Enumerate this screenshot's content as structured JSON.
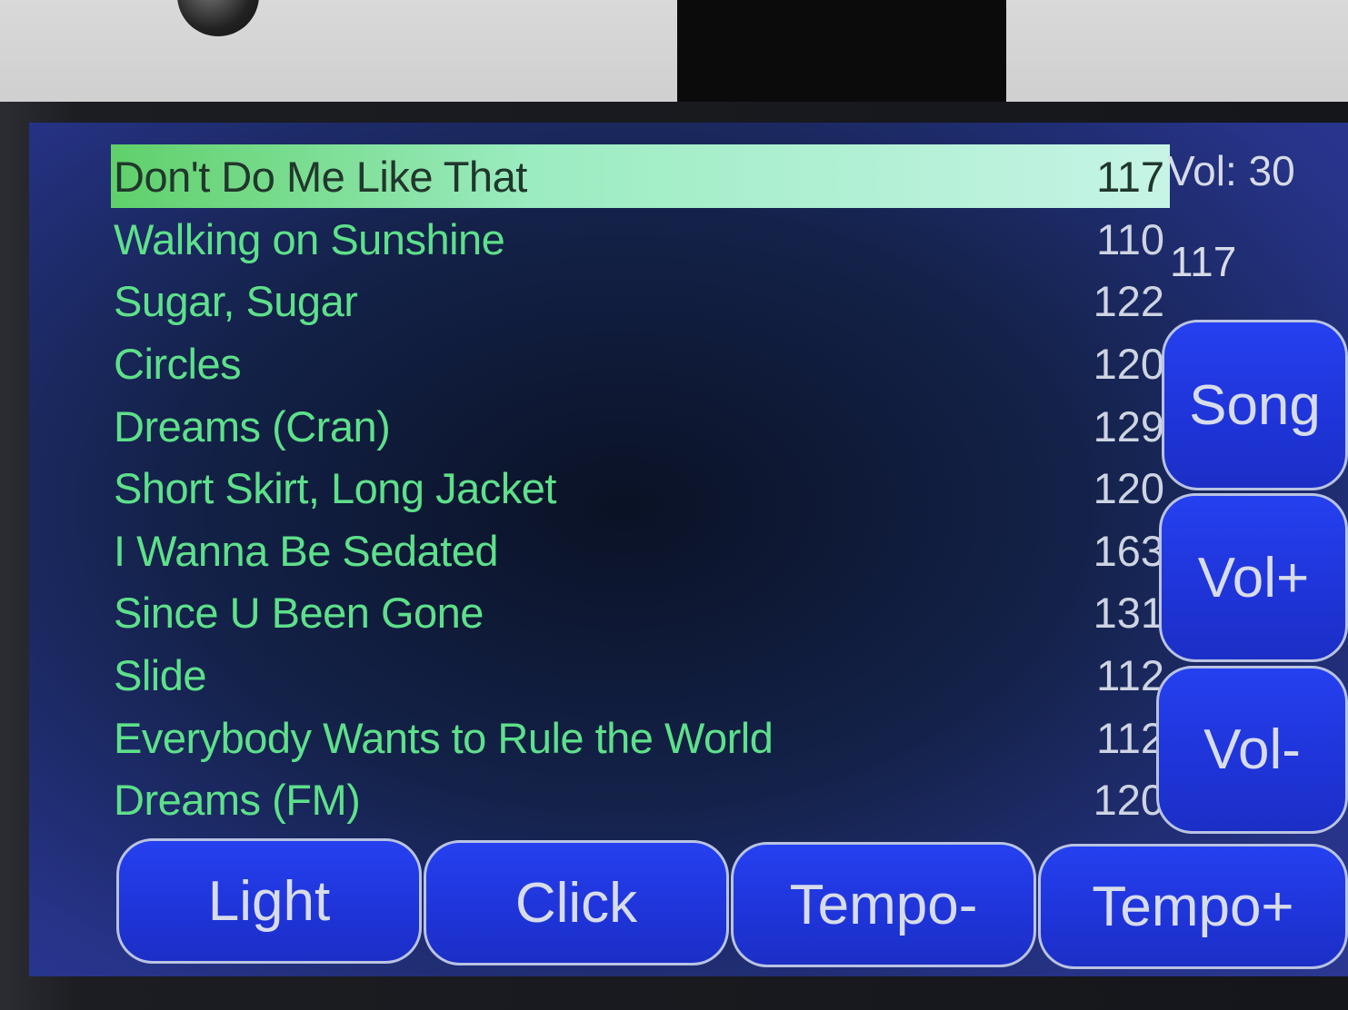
{
  "status": {
    "volume_label": "Vol: 30",
    "current_tempo": "117"
  },
  "songs": [
    {
      "title": "Don't Do Me Like That",
      "tempo": "117",
      "selected": true
    },
    {
      "title": "Walking on Sunshine",
      "tempo": "110"
    },
    {
      "title": "Sugar, Sugar",
      "tempo": "122"
    },
    {
      "title": "Circles",
      "tempo": "120"
    },
    {
      "title": "Dreams (Cran)",
      "tempo": "129"
    },
    {
      "title": "Short Skirt, Long Jacket",
      "tempo": "120"
    },
    {
      "title": "I Wanna Be Sedated",
      "tempo": "163"
    },
    {
      "title": "Since U Been Gone",
      "tempo": "131"
    },
    {
      "title": "Slide",
      "tempo": "112"
    },
    {
      "title": "Everybody Wants to Rule the World",
      "tempo": "112"
    },
    {
      "title": "Dreams (FM)",
      "tempo": "120"
    }
  ],
  "side_buttons": {
    "song": "Song",
    "vol_up": "Vol+",
    "vol_down": "Vol-"
  },
  "bottom_buttons": {
    "light": "Light",
    "click": "Click",
    "tempo_down": "Tempo-",
    "tempo_up": "Tempo+"
  },
  "colors": {
    "song_text": "#5ee08a",
    "selected_row": "#9cecc1",
    "button_fill": "#2540f0"
  }
}
